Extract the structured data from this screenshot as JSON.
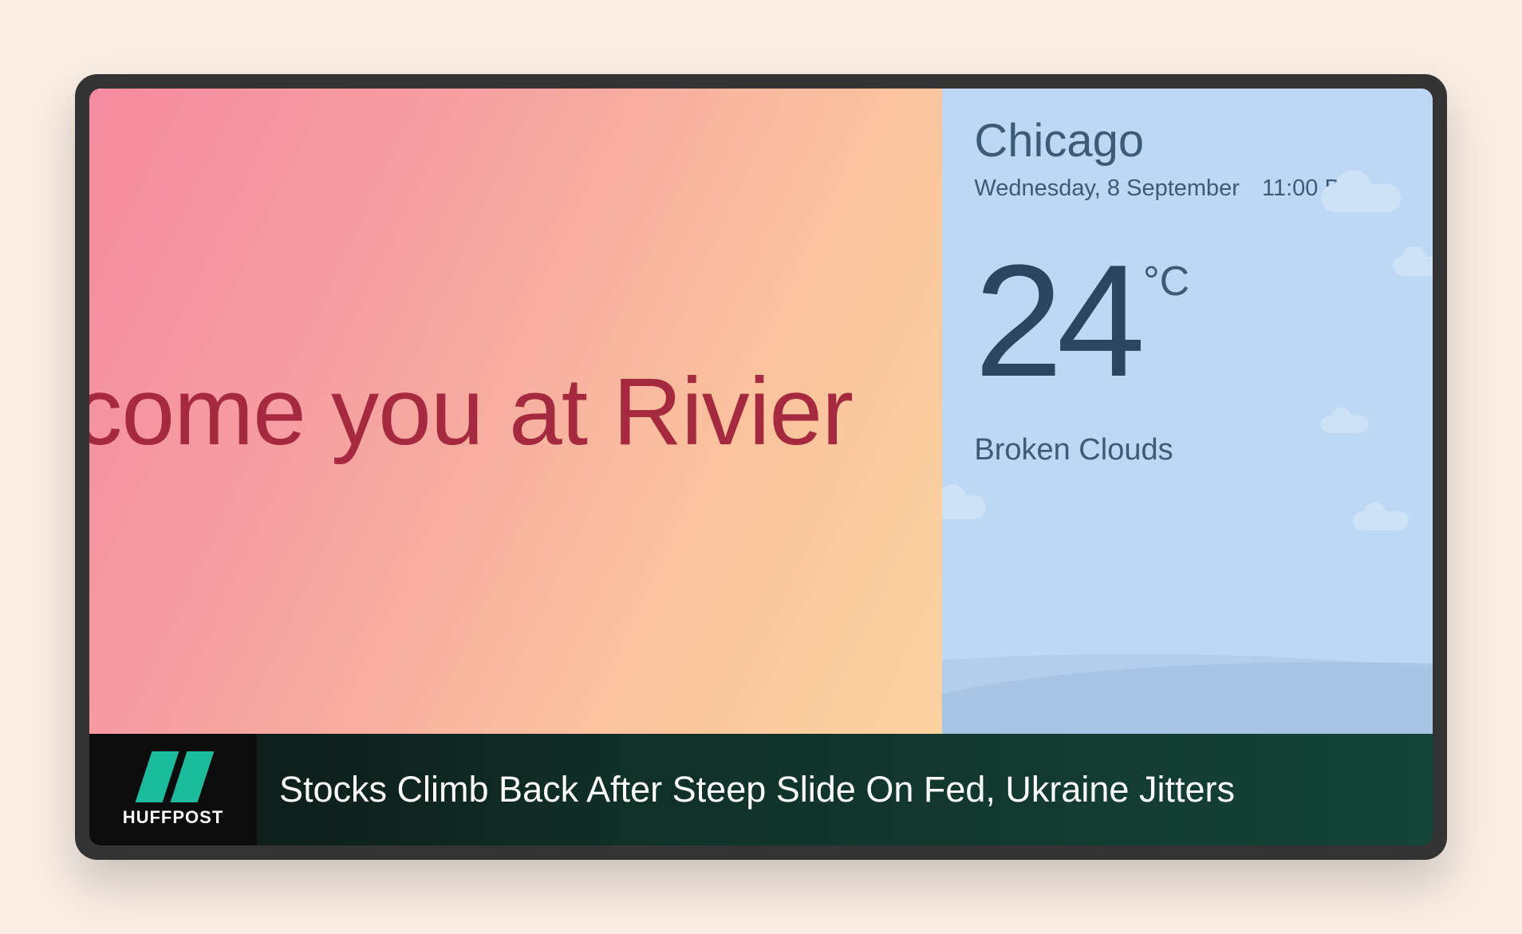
{
  "welcome": {
    "message": "elcome you at Rivier"
  },
  "weather": {
    "city": "Chicago",
    "date": "Wednesday, 8 September",
    "time": "11:00 PM",
    "temperature": "24",
    "unit": "°C",
    "condition": "Broken Clouds"
  },
  "ticker": {
    "logo_label": "HUFFPOST",
    "headline": "Stocks Climb Back After Steep Slide On Fed, Ukraine Jitters"
  }
}
